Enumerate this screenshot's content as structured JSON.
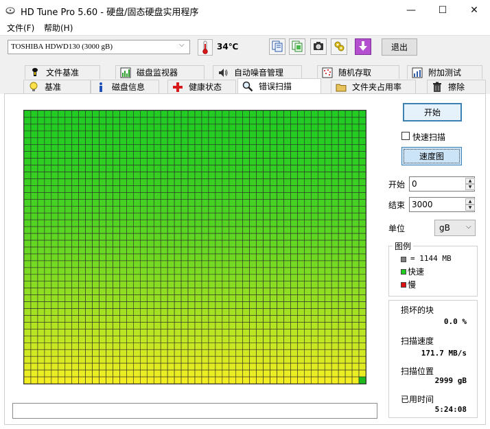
{
  "window": {
    "title": "HD Tune Pro 5.60 - 硬盘/固态硬盘实用程序",
    "minimize_glyph": "—",
    "maximize_glyph": "☐",
    "close_glyph": "✕"
  },
  "menu": {
    "file": "文件(F)",
    "help": "帮助(H)"
  },
  "toolbar": {
    "drive": "TOSHIBA HDWD130 (3000 gB)",
    "temperature": "34℃",
    "icons": [
      "copy-text-icon",
      "copy-info-icon",
      "screenshot-camera-icon",
      "options-wrench-icon",
      "save-download-icon"
    ],
    "exit_label": "退出"
  },
  "tabs": {
    "top_row": [
      "文件基准",
      "磁盘监视器",
      "自动噪音管理",
      "随机存取",
      "附加测试"
    ],
    "bottom_row": [
      "基准",
      "磁盘信息",
      "健康状态",
      "错误扫描",
      "文件夹占用率",
      "擦除"
    ],
    "active": "错误扫描"
  },
  "scan_map": {
    "columns": 50,
    "rows": 40,
    "completed_fraction": 1.0,
    "color_top": "#22cc22",
    "color_bottom": "#f2ee22",
    "last_block_color": "#1eba1e",
    "grid_line_color": "#2a2a2a"
  },
  "controls": {
    "start_label": "开始",
    "quick_scan_label": "快速扫描",
    "quick_scan_checked": false,
    "speed_map_label": "速度图",
    "start_field_label": "开始",
    "start_value": "0",
    "end_field_label": "结束",
    "end_value": "3000",
    "unit_label": "单位",
    "unit_value": "gB"
  },
  "legend": {
    "title": "图例",
    "block_size": "= 1144 MB",
    "ok_label": "快速",
    "bad_label": "慢",
    "block_color": "#808080",
    "ok_color": "#22cc22",
    "bad_color": "#dd1111"
  },
  "stats": {
    "damaged_label": "损坏的块",
    "damaged_value": "0.0 %",
    "speed_label": "扫描速度",
    "speed_value": "171.7 MB/s",
    "position_label": "扫描位置",
    "position_value": "2999 gB",
    "elapsed_label": "已用时间",
    "elapsed_value": "5:24:08"
  },
  "log": {
    "text": ""
  }
}
